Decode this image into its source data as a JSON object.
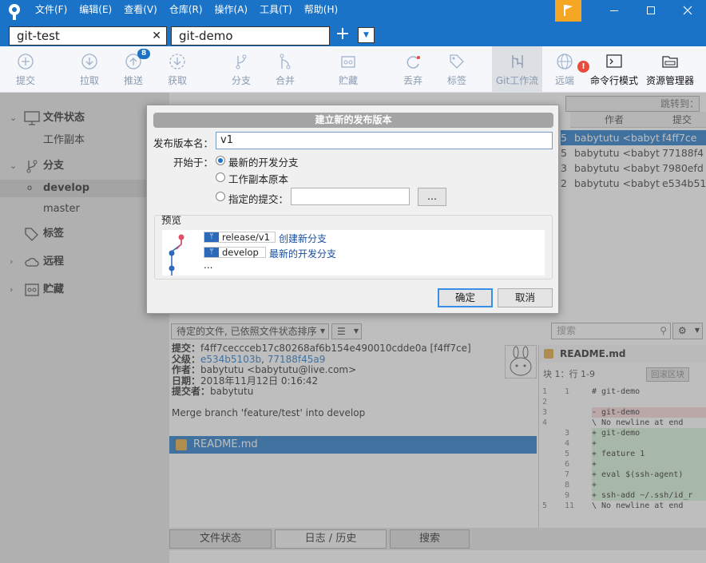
{
  "menu": [
    "文件(F)",
    "编辑(E)",
    "查看(V)",
    "仓库(R)",
    "操作(A)",
    "工具(T)",
    "帮助(H)"
  ],
  "tabs": [
    {
      "label": "git-test"
    },
    {
      "label": "git-demo"
    }
  ],
  "toolbar": {
    "commit": "提交",
    "pull": "拉取",
    "push": "推送",
    "push_badge": "8",
    "fetch": "获取",
    "branch": "分支",
    "merge": "合并",
    "stash": "贮藏",
    "discard": "丢弃",
    "tag": "标签",
    "gitflow": "Git工作流",
    "remote": "远端",
    "remote_alert": "!",
    "terminal": "命令行模式",
    "explorer": "资源管理器"
  },
  "sidebar": {
    "file_status": "文件状态",
    "working_copy": "工作副本",
    "branches": "分支",
    "develop": "develop",
    "master": "master",
    "tags": "标签",
    "remotes": "远程",
    "stashes": "贮藏"
  },
  "commits": {
    "col_author": "作者",
    "col_commit": "提交",
    "rows": [
      {
        "prefix": "5",
        "author": "babytutu <babyt",
        "hash": "f4ff7ce"
      },
      {
        "prefix": "5",
        "author": "babytutu <babyt",
        "hash": "77188f4"
      },
      {
        "prefix": "3",
        "author": "babytutu <babyt",
        "hash": "7980efd"
      },
      {
        "prefix": "2",
        "author": "babytutu <babyt",
        "hash": "e534b51"
      }
    ]
  },
  "filter": {
    "files_sort": "待定的文件, 已依照文件状态排序",
    "search_placeholder": "搜索",
    "jump_to": "跳转到："
  },
  "details": {
    "commit_k": "提交：",
    "commit_v": "f4ff7ceccceb17c80268af6b154e490010cdde0a [f4ff7ce]",
    "parents_k": "父级：",
    "parent1": "e534b5103b",
    "parent_sep": ", ",
    "parent2": "77188f45a9",
    "author_k": "作者：",
    "author_v": "babytutu <babytutu@live.com>",
    "date_k": "日期：",
    "date_v": "2018年11月12日 0:16:42",
    "committer_k": "提交者：",
    "committer_v": "babytutu",
    "message": "Merge branch 'feature/test' into develop",
    "file": "README.md"
  },
  "diff": {
    "file": "README.md",
    "hunk": "块 1：行 1-9",
    "revert": "回滚区块",
    "lines": [
      {
        "n1": "1",
        "n2": "1",
        "t": "  # git-demo",
        "k": ""
      },
      {
        "n1": "2",
        "n2": "",
        "t": "",
        "k": "del"
      },
      {
        "n1": "3",
        "n2": "",
        "t": "- git-demo",
        "k": "del"
      },
      {
        "n1": "4",
        "n2": "",
        "t": "\\  No newline at end",
        "k": ""
      },
      {
        "n1": "",
        "n2": "3",
        "t": "+ git-demo",
        "k": "add"
      },
      {
        "n1": "",
        "n2": "4",
        "t": "+",
        "k": "add"
      },
      {
        "n1": "",
        "n2": "5",
        "t": "+ feature 1",
        "k": "add"
      },
      {
        "n1": "",
        "n2": "6",
        "t": "+",
        "k": "add"
      },
      {
        "n1": "",
        "n2": "7",
        "t": "+ eval $(ssh-agent)",
        "k": "add"
      },
      {
        "n1": "",
        "n2": "8",
        "t": "+",
        "k": "add"
      },
      {
        "n1": "",
        "n2": "9",
        "t": "+ ssh-add ~/.ssh/id_r",
        "k": "add"
      },
      {
        "n1": "5",
        "n2": "11",
        "t": "\\  No newline at end",
        "k": ""
      }
    ]
  },
  "bottom_tabs": [
    "文件状态",
    "日志 / 历史",
    "搜索"
  ],
  "dialog": {
    "title": "建立新的发布版本",
    "name_label": "发布版本名：",
    "name_value": "v1",
    "start_label": "开始于：",
    "opt_latest": "最新的开发分支",
    "opt_working": "工作副本原本",
    "opt_commit": "指定的提交：",
    "browse": "...",
    "preview_label": "预览",
    "new_branch": "release/v1",
    "new_branch_note": "创建新分支",
    "base_branch": "develop",
    "base_branch_note": "最新的开发分支",
    "ellipsis": "...",
    "ok": "确定",
    "cancel": "取消"
  }
}
